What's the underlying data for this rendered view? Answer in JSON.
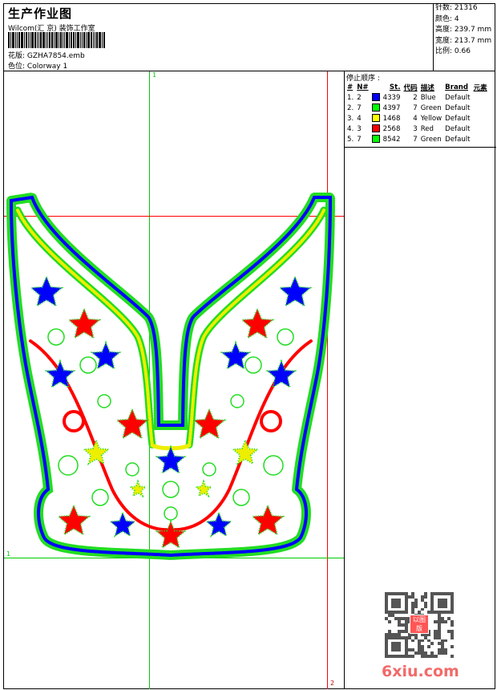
{
  "header": {
    "title": "生产作业图",
    "subtitle": "Wilcom(汇 京) 装饰工作室",
    "design_label": "花版:",
    "design_value": "GZHA7854.emb",
    "colorway_label": "色位:",
    "colorway_value": "Colorway 1"
  },
  "stats": [
    {
      "label": "针数:",
      "value": "21316"
    },
    {
      "label": "颜色:",
      "value": "4"
    },
    {
      "label": "高度:",
      "value": "239.7 mm"
    },
    {
      "label": "宽度:",
      "value": "213.7 mm"
    },
    {
      "label": "比例:",
      "value": "0.66"
    }
  ],
  "stop_sequence": {
    "caption": "停止顺序 :",
    "headers": [
      "#",
      "N#",
      "St.",
      "代码",
      "描述",
      "Brand",
      "元素"
    ],
    "rows": [
      {
        "num": "1.",
        "n": "2",
        "color": "#0000ff",
        "st": "4339",
        "code": "2",
        "desc": "Blue",
        "brand": "Default"
      },
      {
        "num": "2.",
        "n": "7",
        "color": "#00ff00",
        "st": "4397",
        "code": "7",
        "desc": "Green",
        "brand": "Default"
      },
      {
        "num": "3.",
        "n": "4",
        "color": "#ffff00",
        "st": "1468",
        "code": "4",
        "desc": "Yellow",
        "brand": "Default"
      },
      {
        "num": "4.",
        "n": "3",
        "color": "#ff0000",
        "st": "2568",
        "code": "3",
        "desc": "Red",
        "brand": "Default"
      },
      {
        "num": "5.",
        "n": "7",
        "color": "#00ff00",
        "st": "8542",
        "code": "7",
        "desc": "Green",
        "brand": "Default"
      }
    ]
  },
  "guides": {
    "top_marker": "1",
    "left_marker": "1",
    "bottom_marker": "2"
  },
  "watermark": {
    "text": "6xiu.com",
    "stamp": "以图版"
  }
}
